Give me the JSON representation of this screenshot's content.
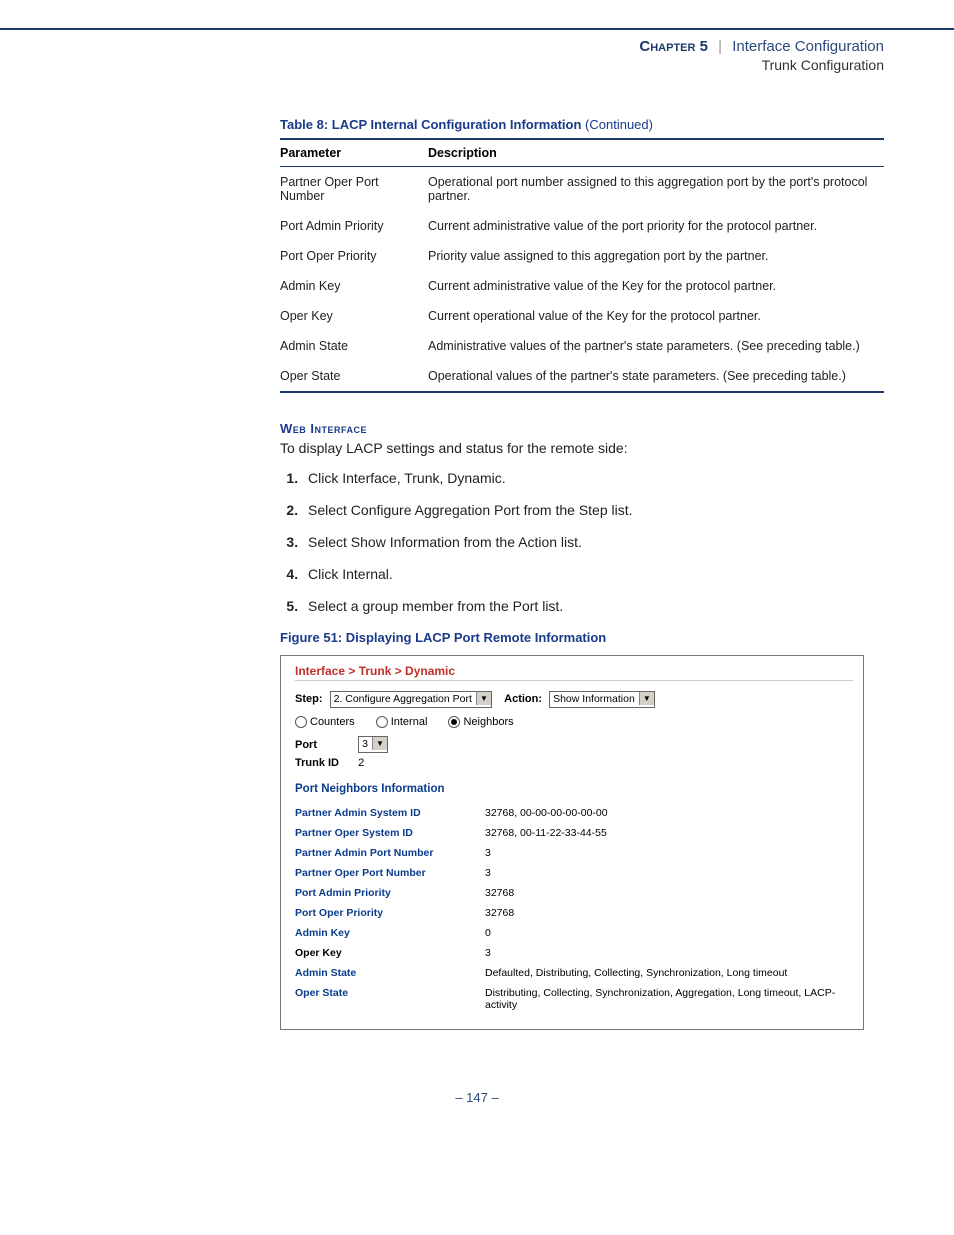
{
  "header": {
    "chapter": "Chapter 5",
    "title": "Interface Configuration",
    "subtitle": "Trunk Configuration"
  },
  "table": {
    "caption_main": "Table 8: LACP Internal Configuration Information",
    "caption_cont": "(Continued)",
    "col_param": "Parameter",
    "col_desc": "Description",
    "rows": [
      {
        "p": "Partner Oper Port Number",
        "d": "Operational port number assigned to this aggregation port by the port's protocol partner."
      },
      {
        "p": "Port Admin Priority",
        "d": "Current administrative value of the port priority for the protocol partner."
      },
      {
        "p": "Port Oper Priority",
        "d": "Priority value assigned to this aggregation port by the partner."
      },
      {
        "p": "Admin Key",
        "d": "Current administrative value of the Key for the protocol partner."
      },
      {
        "p": "Oper Key",
        "d": "Current operational value of the Key for the protocol partner."
      },
      {
        "p": "Admin State",
        "d": "Administrative values of the partner's state parameters. (See preceding table.)"
      },
      {
        "p": "Oper State",
        "d": "Operational values of the partner's state parameters. (See preceding table.)"
      }
    ]
  },
  "web": {
    "heading": "Web Interface",
    "intro": "To display LACP settings and status for the remote side:",
    "steps": [
      "Click Interface, Trunk, Dynamic.",
      "Select Configure Aggregation Port from the Step list.",
      "Select Show Information from the Action list.",
      "Click Internal.",
      "Select a group member from the Port list."
    ]
  },
  "figure": {
    "caption": "Figure 51:  Displaying LACP Port Remote Information"
  },
  "shot": {
    "breadcrumb": "Interface > Trunk > Dynamic",
    "step_label": "Step:",
    "step_value": "2. Configure Aggregation Port",
    "action_label": "Action:",
    "action_value": "Show Information",
    "radios": {
      "counters": "Counters",
      "internal": "Internal",
      "neighbors": "Neighbors"
    },
    "port_label": "Port",
    "port_value": "3",
    "trunk_label": "Trunk ID",
    "trunk_value": "2",
    "section_title": "Port Neighbors Information",
    "info": [
      {
        "k": "Partner Admin System ID",
        "v": "32768, 00-00-00-00-00-00",
        "blue": true
      },
      {
        "k": "Partner Oper System ID",
        "v": "32768, 00-11-22-33-44-55",
        "blue": true
      },
      {
        "k": "Partner Admin Port Number",
        "v": "3",
        "blue": true
      },
      {
        "k": "Partner Oper Port Number",
        "v": "3",
        "blue": true
      },
      {
        "k": "Port Admin Priority",
        "v": "32768",
        "blue": true
      },
      {
        "k": "Port Oper Priority",
        "v": "32768",
        "blue": true
      },
      {
        "k": "Admin Key",
        "v": "0",
        "blue": true
      },
      {
        "k": "Oper Key",
        "v": "3",
        "blue": false
      },
      {
        "k": "Admin State",
        "v": "Defaulted, Distributing, Collecting, Synchronization, Long timeout",
        "blue": true
      },
      {
        "k": "Oper State",
        "v": "Distributing, Collecting, Synchronization, Aggregation, Long timeout, LACP-activity",
        "blue": true
      }
    ]
  },
  "footer": {
    "page": "–  147  –"
  }
}
